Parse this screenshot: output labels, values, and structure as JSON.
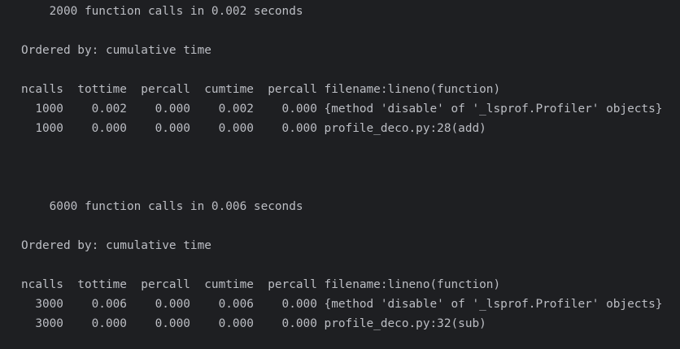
{
  "colors": {
    "background": "#1e1f22",
    "text": "#bcbec4"
  },
  "profiles": [
    {
      "summary": "       2000 function calls in 0.002 seconds",
      "ordered_by": "   Ordered by: cumulative time",
      "header": "   ncalls  tottime  percall  cumtime  percall filename:lineno(function)",
      "rows": [
        "     1000    0.002    0.000    0.002    0.000 {method 'disable' of '_lsprof.Profiler' objects}",
        "     1000    0.000    0.000    0.000    0.000 profile_deco.py:28(add)"
      ]
    },
    {
      "summary": "       6000 function calls in 0.006 seconds",
      "ordered_by": "   Ordered by: cumulative time",
      "header": "   ncalls  tottime  percall  cumtime  percall filename:lineno(function)",
      "rows": [
        "     3000    0.006    0.000    0.006    0.000 {method 'disable' of '_lsprof.Profiler' objects}",
        "     3000    0.000    0.000    0.000    0.000 profile_deco.py:32(sub)"
      ]
    }
  ]
}
